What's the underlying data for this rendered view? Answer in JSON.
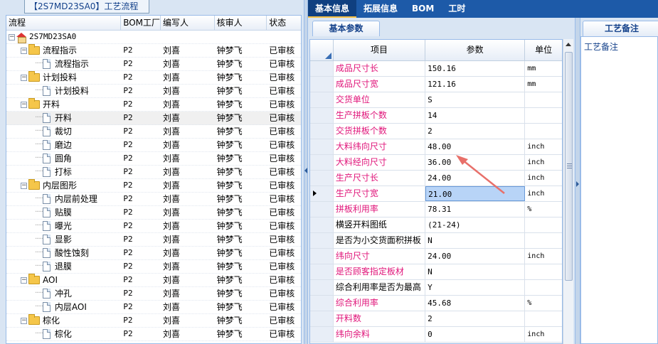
{
  "left": {
    "title_tab": "【2S7MD23SA0】工艺流程",
    "columns": [
      "流程",
      "BOM工厂",
      "编写人",
      "核审人",
      "状态"
    ],
    "root": "2S7MD23SA0",
    "rows": [
      {
        "name": "流程指示",
        "kind": "folder",
        "bom": "P2",
        "writer": "刘喜",
        "reviewer": "钟梦飞",
        "status": "已审核"
      },
      {
        "name": "流程指示",
        "kind": "doc",
        "bom": "P2",
        "writer": "刘喜",
        "reviewer": "钟梦飞",
        "status": "已审核"
      },
      {
        "name": "计划投料",
        "kind": "folder",
        "bom": "P2",
        "writer": "刘喜",
        "reviewer": "钟梦飞",
        "status": "已审核"
      },
      {
        "name": "计划投料",
        "kind": "doc",
        "bom": "P2",
        "writer": "刘喜",
        "reviewer": "钟梦飞",
        "status": "已审核"
      },
      {
        "name": "开料",
        "kind": "folder",
        "bom": "P2",
        "writer": "刘喜",
        "reviewer": "钟梦飞",
        "status": "已审核"
      },
      {
        "name": "开料",
        "kind": "doc",
        "bom": "P2",
        "writer": "刘喜",
        "reviewer": "钟梦飞",
        "status": "已审核",
        "selected": true
      },
      {
        "name": "裁切",
        "kind": "doc",
        "bom": "P2",
        "writer": "刘喜",
        "reviewer": "钟梦飞",
        "status": "已审核"
      },
      {
        "name": "磨边",
        "kind": "doc",
        "bom": "P2",
        "writer": "刘喜",
        "reviewer": "钟梦飞",
        "status": "已审核"
      },
      {
        "name": "圆角",
        "kind": "doc",
        "bom": "P2",
        "writer": "刘喜",
        "reviewer": "钟梦飞",
        "status": "已审核"
      },
      {
        "name": "打标",
        "kind": "doc",
        "bom": "P2",
        "writer": "刘喜",
        "reviewer": "钟梦飞",
        "status": "已审核"
      },
      {
        "name": "内层图形",
        "kind": "folder",
        "bom": "P2",
        "writer": "刘喜",
        "reviewer": "钟梦飞",
        "status": "已审核"
      },
      {
        "name": "内层前处理",
        "kind": "doc",
        "bom": "P2",
        "writer": "刘喜",
        "reviewer": "钟梦飞",
        "status": "已审核"
      },
      {
        "name": "贴膜",
        "kind": "doc",
        "bom": "P2",
        "writer": "刘喜",
        "reviewer": "钟梦飞",
        "status": "已审核"
      },
      {
        "name": "曝光",
        "kind": "doc",
        "bom": "P2",
        "writer": "刘喜",
        "reviewer": "钟梦飞",
        "status": "已审核"
      },
      {
        "name": "显影",
        "kind": "doc",
        "bom": "P2",
        "writer": "刘喜",
        "reviewer": "钟梦飞",
        "status": "已审核"
      },
      {
        "name": "酸性蚀刻",
        "kind": "doc",
        "bom": "P2",
        "writer": "刘喜",
        "reviewer": "钟梦飞",
        "status": "已审核"
      },
      {
        "name": "退膜",
        "kind": "doc",
        "bom": "P2",
        "writer": "刘喜",
        "reviewer": "钟梦飞",
        "status": "已审核"
      },
      {
        "name": "AOI",
        "kind": "folder",
        "bom": "P2",
        "writer": "刘喜",
        "reviewer": "钟梦飞",
        "status": "已审核"
      },
      {
        "name": "冲孔",
        "kind": "doc",
        "bom": "P2",
        "writer": "刘喜",
        "reviewer": "钟梦飞",
        "status": "已审核"
      },
      {
        "name": "内层AOI",
        "kind": "doc",
        "bom": "P2",
        "writer": "刘喜",
        "reviewer": "钟梦飞",
        "status": "已审核"
      },
      {
        "name": "棕化",
        "kind": "folder",
        "bom": "P2",
        "writer": "刘喜",
        "reviewer": "钟梦飞",
        "status": "已审核"
      },
      {
        "name": "棕化",
        "kind": "doc",
        "bom": "P2",
        "writer": "刘喜",
        "reviewer": "钟梦飞",
        "status": "已审核"
      }
    ]
  },
  "top_tabs": [
    "基本信息",
    "拓展信息",
    "BOM",
    "工时"
  ],
  "middle": {
    "sub_tab": "基本参数",
    "columns": [
      "项目",
      "参数",
      "单位"
    ],
    "rows": [
      {
        "label": "成品尺寸长",
        "value": "150.16",
        "unit": "mm",
        "color": "#e0157a"
      },
      {
        "label": "成品尺寸宽",
        "value": "121.16",
        "unit": "mm",
        "color": "#e0157a"
      },
      {
        "label": "交货单位",
        "value": "S",
        "unit": "",
        "color": "#e0157a"
      },
      {
        "label": "生产拼板个数",
        "value": "14",
        "unit": "",
        "color": "#e0157a"
      },
      {
        "label": "交货拼板个数",
        "value": "2",
        "unit": "",
        "color": "#e0157a"
      },
      {
        "label": "大料纬向尺寸",
        "value": "48.00",
        "unit": "inch",
        "color": "#e0157a"
      },
      {
        "label": "大料经向尺寸",
        "value": "36.00",
        "unit": "inch",
        "color": "#e0157a"
      },
      {
        "label": "生产尺寸长",
        "value": "24.00",
        "unit": "inch",
        "color": "#e0157a"
      },
      {
        "label": "生产尺寸宽",
        "value": "21.00",
        "unit": "inch",
        "color": "#e0157a",
        "current": true
      },
      {
        "label": "拼板利用率",
        "value": "78.31",
        "unit": "%",
        "color": "#e0157a"
      },
      {
        "label": "横竖开料图纸",
        "value": "(21-24)",
        "unit": "",
        "color": "#000000"
      },
      {
        "label": "是否为小交货面积拼板",
        "value": "N",
        "unit": "",
        "color": "#000000"
      },
      {
        "label": "纬向尺寸",
        "value": "24.00",
        "unit": "inch",
        "color": "#e0157a"
      },
      {
        "label": "是否顾客指定板材",
        "value": "N",
        "unit": "",
        "color": "#e0157a"
      },
      {
        "label": "综合利用率是否为最高",
        "value": "Y",
        "unit": "",
        "color": "#000000"
      },
      {
        "label": "综合利用率",
        "value": "45.68",
        "unit": "%",
        "color": "#e0157a"
      },
      {
        "label": "开料数",
        "value": "2",
        "unit": "",
        "color": "#e0157a"
      },
      {
        "label": "纬向余料",
        "value": "0",
        "unit": "inch",
        "color": "#e0157a"
      }
    ]
  },
  "right": {
    "tab": "工艺备注",
    "label": "工艺备注"
  }
}
